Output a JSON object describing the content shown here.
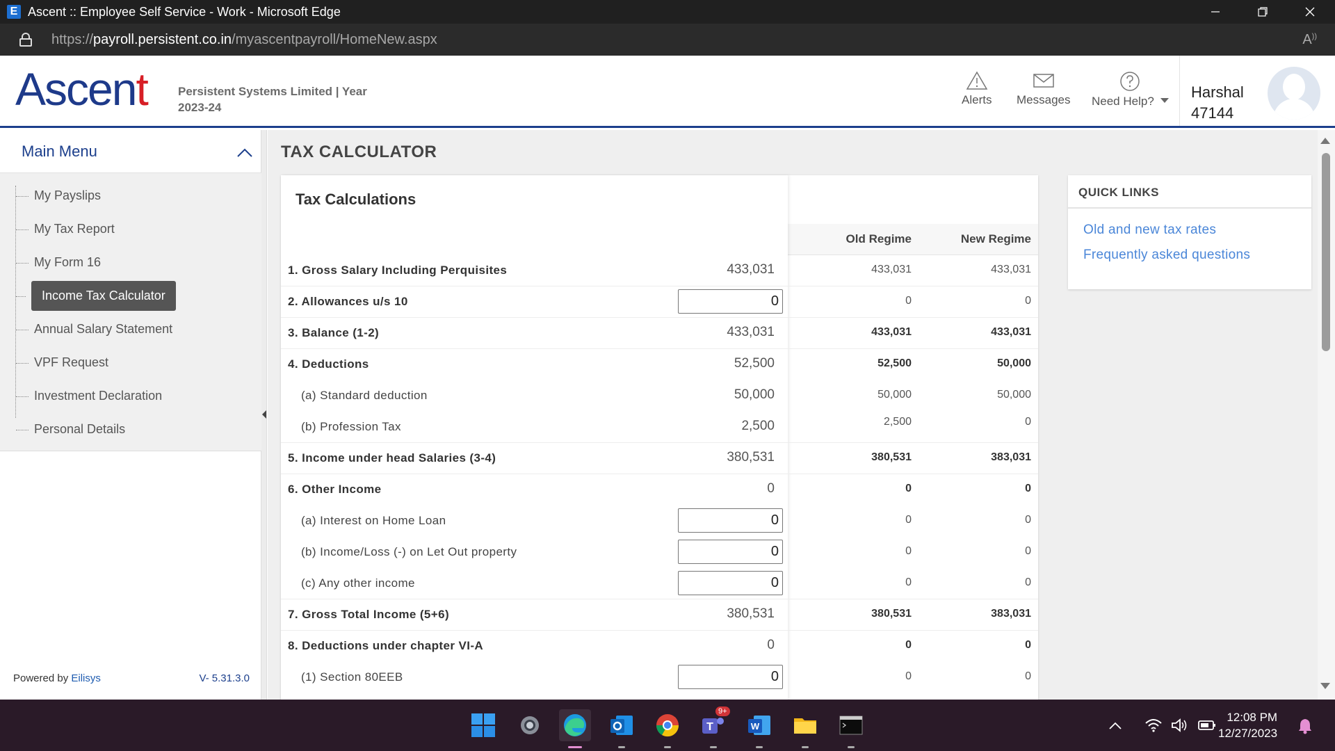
{
  "browser": {
    "window_title": "Ascent :: Employee Self Service - Work - Microsoft Edge",
    "url_prefix": "https://",
    "url_host": "payroll.persistent.co.in",
    "url_path": "/myascentpayroll/HomeNew.aspx",
    "edge_badge": "E"
  },
  "header": {
    "logo_text_a": "Ascen",
    "logo_text_b": "t",
    "company_line1": "Persistent Systems Limited | Year",
    "company_line2": "2023-24",
    "alerts_label": "Alerts",
    "messages_label": "Messages",
    "help_label": "Need Help?",
    "user_name": "Harshal",
    "user_id": "47144"
  },
  "sidebar": {
    "title": "Main Menu",
    "items": [
      {
        "label": "My Payslips"
      },
      {
        "label": "My Tax Report"
      },
      {
        "label": "My Form 16"
      },
      {
        "label": "Income Tax Calculator",
        "active": true
      },
      {
        "label": "Annual Salary Statement"
      },
      {
        "label": "VPF Request"
      },
      {
        "label": "Investment Declaration"
      },
      {
        "label": "Personal Details"
      }
    ],
    "powered_by": "Powered by",
    "powered_brand": "Eilisys",
    "version": "V- 5.31.3.0"
  },
  "main": {
    "page_title": "TAX CALCULATOR",
    "card_title": "Tax Calculations",
    "col_old": "Old Regime",
    "col_new": "New Regime",
    "rows": [
      {
        "label": "1. Gross Salary Including Perquisites",
        "value": "433,031",
        "old": "433,031",
        "new": "433,031"
      },
      {
        "label": "2. Allowances u/s 10",
        "input": "0",
        "old": "0",
        "new": "0"
      },
      {
        "label": "3. Balance (1-2)",
        "value": "433,031",
        "old": "433,031",
        "new": "433,031"
      },
      {
        "label": "4. Deductions",
        "value": "52,500",
        "old": "52,500",
        "new": "50,000"
      },
      {
        "label": "(a) Standard deduction",
        "value": "50,000",
        "old": "50,000",
        "new": "50,000"
      },
      {
        "label": "(b) Profession Tax",
        "value": "2,500",
        "old": "2,500",
        "new": "0"
      },
      {
        "label": "5. Income under head Salaries (3-4)",
        "value": "380,531",
        "old": "380,531",
        "new": "383,031"
      },
      {
        "label": "6. Other Income",
        "value": "0",
        "old": "0",
        "new": "0"
      },
      {
        "label": "(a) Interest on Home Loan",
        "input": "0",
        "old": "0",
        "new": "0"
      },
      {
        "label": "(b) Income/Loss (-) on Let Out property",
        "input": "0",
        "old": "0",
        "new": "0"
      },
      {
        "label": "(c) Any other income",
        "input": "0",
        "old": "0",
        "new": "0"
      },
      {
        "label": "7. Gross Total Income (5+6)",
        "value": "380,531",
        "old": "380,531",
        "new": "383,031"
      },
      {
        "label": "8. Deductions under chapter VI-A",
        "value": "0",
        "old": "0",
        "new": "0"
      },
      {
        "label": "(1) Section 80EEB",
        "input": "0",
        "old": "0",
        "new": "0"
      }
    ]
  },
  "quick_links": {
    "title": "QUICK LINKS",
    "links": [
      {
        "label": "Old and new tax rates"
      },
      {
        "label": "Frequently asked questions"
      }
    ]
  },
  "taskbar": {
    "time": "12:08 PM",
    "date": "12/27/2023",
    "teams_badge": "9+",
    "word_letter": "W",
    "teams_letter": "T"
  },
  "colors": {
    "brand_blue": "#1c3f8c",
    "logo_red": "#d71f26",
    "link_blue": "#4a86d8",
    "active_menu_bg": "#555555",
    "taskbar_bg": "#2a1a28"
  },
  "icons": [
    "edge-icon",
    "lock-icon",
    "read-aloud-icon",
    "alert-triangle-icon",
    "envelope-icon",
    "help-circle-icon",
    "caret-down-icon",
    "chevron-up-icon",
    "windows-start-icon",
    "settings-icon",
    "outlook-icon",
    "chrome-icon",
    "teams-icon",
    "word-icon",
    "file-explorer-icon",
    "terminal-icon",
    "wifi-icon",
    "volume-icon",
    "battery-icon",
    "bell-icon"
  ]
}
